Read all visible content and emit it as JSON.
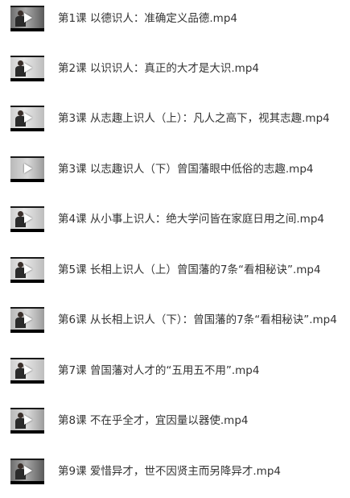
{
  "files": [
    {
      "name": "第1课 以德识人：准确定义品德.mp4",
      "icon": "video-thumbnail-icon"
    },
    {
      "name": "第2课 以识识人：真正的大才是大识.mp4",
      "icon": "video-thumbnail-icon"
    },
    {
      "name": "第3课 从志趣上识人（上）：凡人之高下，视其志趣.mp4",
      "icon": "video-thumbnail-icon"
    },
    {
      "name": "第3课 以志趣识人（下）曾国藩眼中低俗的志趣.mp4",
      "icon": "video-thumbnail-icon"
    },
    {
      "name": "第4课 从小事上识人：绝大学问皆在家庭日用之间.mp4",
      "icon": "video-thumbnail-icon"
    },
    {
      "name": "第5课 长相上识人（上）曾国藩的7条“看相秘诀”.mp4",
      "icon": "video-thumbnail-icon"
    },
    {
      "name": "第6课 从长相上识人（下）：曾国藩的7条“看相秘诀”.mp4",
      "icon": "video-thumbnail-icon"
    },
    {
      "name": "第7课 曾国藩对人才的“五用五不用”.mp4",
      "icon": "video-thumbnail-icon"
    },
    {
      "name": "第8课 不在乎全才，宜因量以器使.mp4",
      "icon": "video-thumbnail-icon"
    },
    {
      "name": "第9课 爱惜异才，世不因贤主而另降异才.mp4",
      "icon": "video-thumbnail-icon"
    }
  ]
}
